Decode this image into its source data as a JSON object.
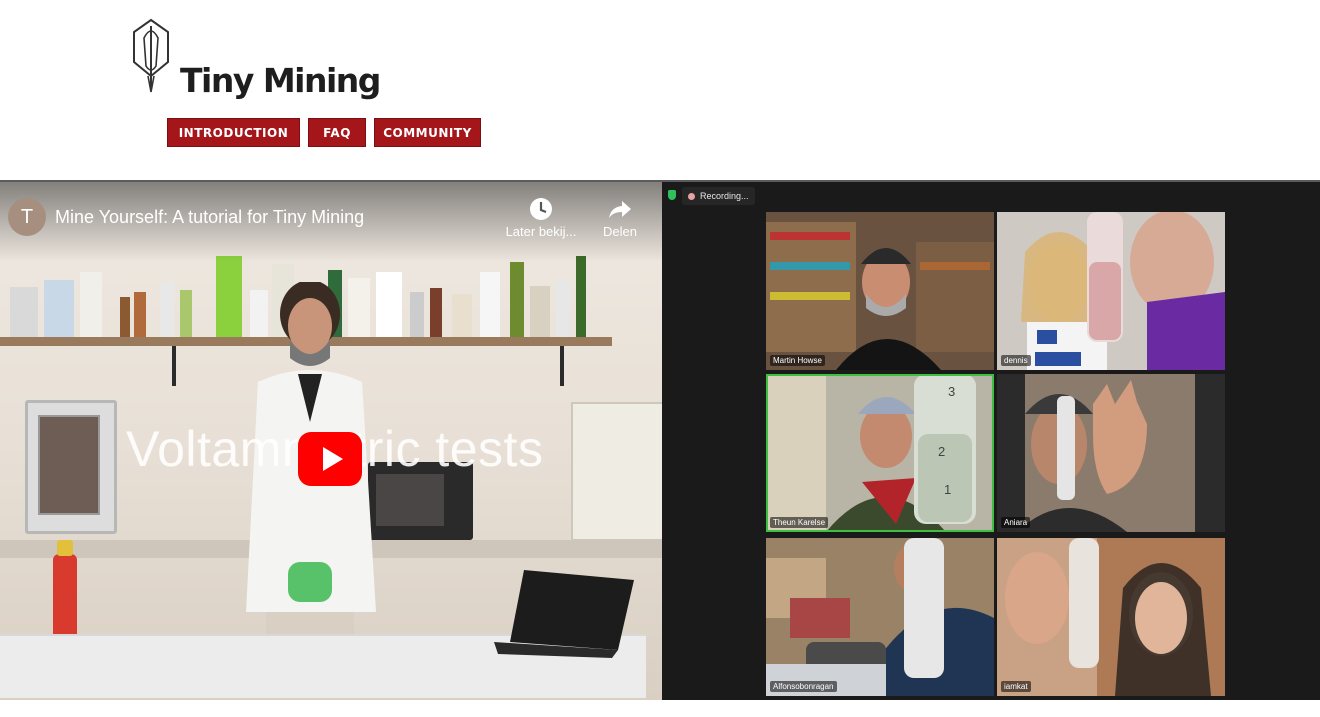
{
  "header": {
    "logo_text": "Tiny Mining",
    "nav": [
      "INTRODUCTION",
      "FAQ",
      "COMMUNITY"
    ]
  },
  "video": {
    "channel_initial": "T",
    "title": "Mine Yourself: A tutorial for Tiny Mining",
    "watch_later_label": "Later bekij...",
    "share_label": "Delen",
    "overlay_text": "Voltammetric tests"
  },
  "zoom": {
    "recording_label": "Recording...",
    "participants": [
      "Martin Howse",
      "dennis",
      "Theun Karelse",
      "Aniara",
      "Alfonsobonragan",
      "iamkat"
    ]
  },
  "colors": {
    "nav_red": "#a5161a",
    "youtube_red": "#ff0000",
    "active_speaker": "#3fbf3f"
  }
}
